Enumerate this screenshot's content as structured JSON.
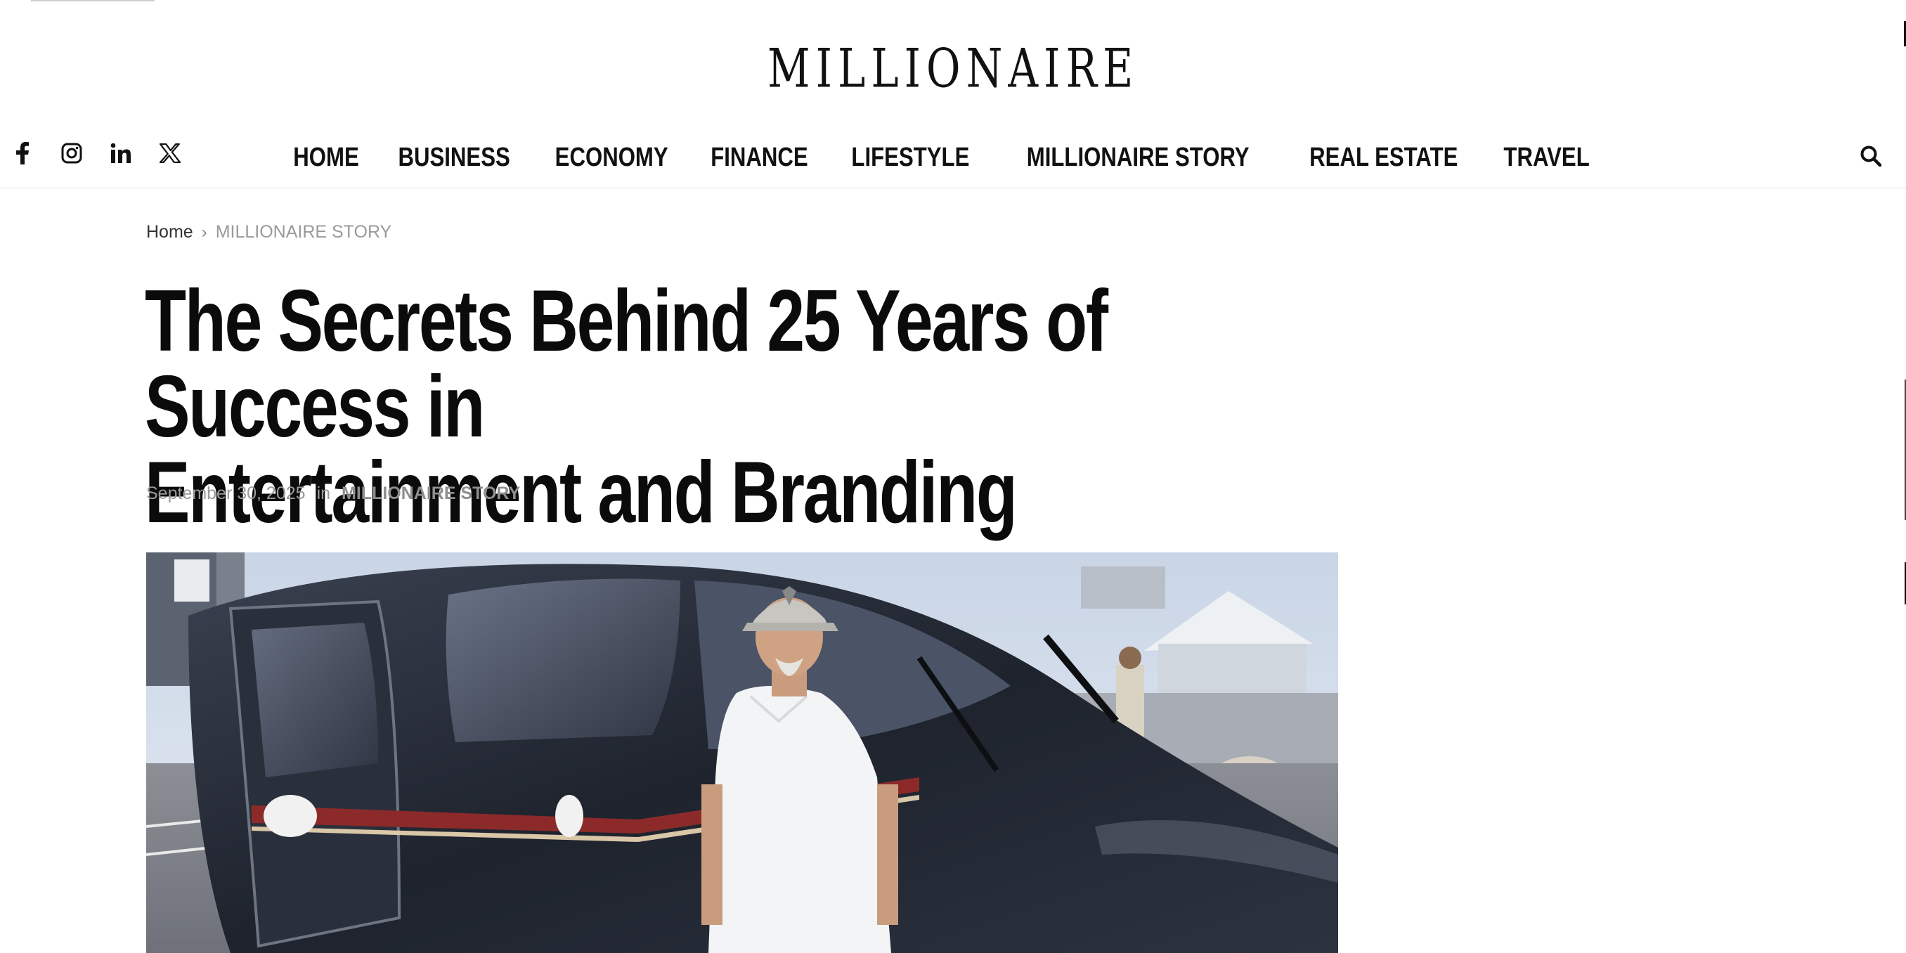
{
  "site": {
    "logo_text": "MILLIONAIRE"
  },
  "header": {
    "socials": [
      {
        "name": "facebook-icon"
      },
      {
        "name": "instagram-icon"
      },
      {
        "name": "linkedin-icon"
      },
      {
        "name": "x-icon"
      }
    ],
    "nav": [
      "HOME",
      "BUSINESS",
      "ECONOMY",
      "FINANCE",
      "LIFESTYLE",
      "MILLIONAIRE STORY",
      "REAL ESTATE",
      "TRAVEL"
    ],
    "search_icon": "search-icon"
  },
  "breadcrumb": {
    "home": "Home",
    "separator": "›",
    "current": "MILLIONAIRE STORY"
  },
  "article": {
    "title_line1": "The Secrets Behind 25 Years of Success in",
    "title_line2": "Entertainment and Branding",
    "date": "September 30, 2025",
    "in_label": "in",
    "category": "MILLIONAIRE STORY"
  },
  "colors": {
    "text": "#111111",
    "muted": "#9a9a9a",
    "divider": "#e2e2e2"
  }
}
